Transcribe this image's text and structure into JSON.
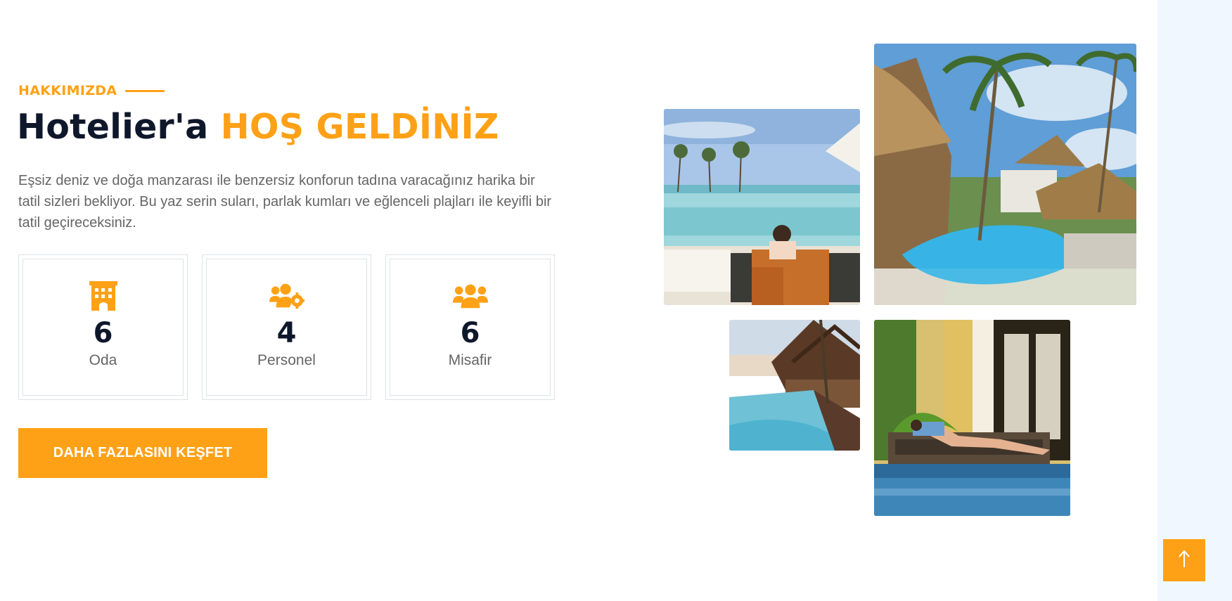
{
  "about": {
    "eyebrow": "HAKKIMIZDA",
    "heading_main": "Hotelier'a",
    "heading_accent": "HOŞ GELDİNİZ",
    "description": "Eşsiz deniz ve doğa manzarası ile benzersiz konforun tadına varacağınız harika bir tatil sizleri bekliyor. Bu yaz serin suları, parlak kumları ve eğlenceli plajları ile keyifli bir tatil geçireceksiniz."
  },
  "stats": [
    {
      "icon": "hotel-icon",
      "number": "6",
      "label": "Oda"
    },
    {
      "icon": "users-cog-icon",
      "number": "4",
      "label": "Personel"
    },
    {
      "icon": "users-icon",
      "number": "6",
      "label": "Misafir"
    }
  ],
  "cta": {
    "label": "DAHA FAZLASINI KEŞFET"
  },
  "gallery": [
    {
      "name": "beach-pool-lounger-photo"
    },
    {
      "name": "tropical-pool-palms-photo"
    },
    {
      "name": "pool-deck-lodge-photo"
    },
    {
      "name": "poolside-sunbather-photo"
    }
  ],
  "back_to_top": {
    "icon": "arrow-up-icon"
  },
  "colors": {
    "accent": "#fea116",
    "heading": "#0f172b",
    "text": "#666565",
    "border": "#dee2e6",
    "side_panel": "#f1f7ff"
  }
}
